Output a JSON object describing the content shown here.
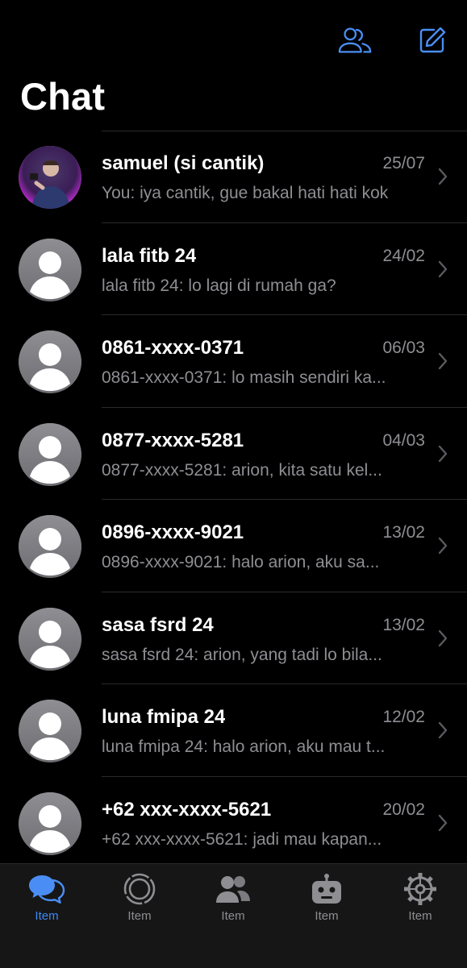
{
  "header": {
    "title": "Chat",
    "contacts_icon": "contacts-icon",
    "compose_icon": "compose-icon",
    "accent_color": "#4a8ef5"
  },
  "chats": [
    {
      "name": "samuel (si cantik)",
      "date": "25/07",
      "preview": "You: iya cantik, gue bakal hati hati kok",
      "avatar": "photo"
    },
    {
      "name": "lala fitb 24",
      "date": "24/02",
      "preview": "lala fitb 24: lo lagi di rumah ga?",
      "avatar": "default"
    },
    {
      "name": "0861-xxxx-0371",
      "date": "06/03",
      "preview": "0861-xxxx-0371: lo masih sendiri ka...",
      "avatar": "default"
    },
    {
      "name": "0877-xxxx-5281",
      "date": "04/03",
      "preview": "0877-xxxx-5281: arion, kita satu kel...",
      "avatar": "default"
    },
    {
      "name": "0896-xxxx-9021",
      "date": "13/02",
      "preview": "0896-xxxx-9021: halo arion, aku sa...",
      "avatar": "default"
    },
    {
      "name": "sasa fsrd 24",
      "date": "13/02",
      "preview": "sasa fsrd 24: arion, yang tadi lo bila...",
      "avatar": "default"
    },
    {
      "name": "luna fmipa 24",
      "date": "12/02",
      "preview": "luna fmipa 24: halo arion, aku mau t...",
      "avatar": "default"
    },
    {
      "name": "+62 xxx-xxxx-5621",
      "date": "20/02",
      "preview": "+62 xxx-xxxx-5621: jadi mau kapan...",
      "avatar": "default"
    }
  ],
  "tabs": [
    {
      "label": "Item",
      "icon": "chat-bubbles-icon",
      "active": true
    },
    {
      "label": "Item",
      "icon": "status-ring-icon",
      "active": false
    },
    {
      "label": "Item",
      "icon": "people-icon",
      "active": false
    },
    {
      "label": "Item",
      "icon": "bot-icon",
      "active": false
    },
    {
      "label": "Item",
      "icon": "gear-icon",
      "active": false
    }
  ]
}
